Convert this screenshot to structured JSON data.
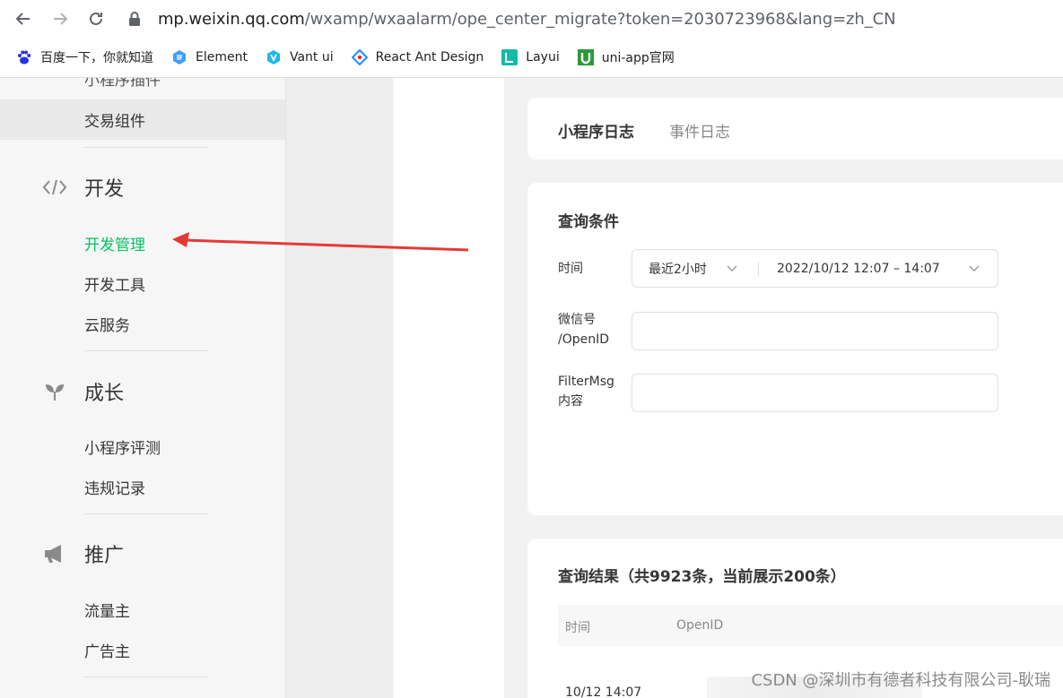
{
  "browser": {
    "url_host": "mp.weixin.qq.com",
    "url_path": "/wxamp/wxaalarm/ope_center_migrate?token=2030723968&lang=zh_CN",
    "bookmarks": [
      {
        "label": "百度一下，你就知道",
        "icon": "baidu-paw-icon",
        "color": "#2932e1"
      },
      {
        "label": "Element",
        "icon": "element-hex-icon",
        "color": "#409eff"
      },
      {
        "label": "Vant ui",
        "icon": "vant-icon",
        "color": "#1989fa"
      },
      {
        "label": "React Ant Design",
        "icon": "ant-design-icon",
        "color": "#1890ff"
      },
      {
        "label": "Layui",
        "icon": "layui-icon",
        "color": "#16baaa"
      },
      {
        "label": "uni-app官网",
        "icon": "uniapp-icon",
        "color": "#2b9939"
      }
    ]
  },
  "sidebar": {
    "clipped_item": "小程序插件",
    "selected_item": "交易组件",
    "groups": [
      {
        "label": "开发",
        "icon": "code-icon",
        "items": [
          "开发管理",
          "开发工具",
          "云服务"
        ]
      },
      {
        "label": "成长",
        "icon": "sprout-icon",
        "items": [
          "小程序评测",
          "违规记录"
        ]
      },
      {
        "label": "推广",
        "icon": "megaphone-icon",
        "items": [
          "流量主",
          "广告主"
        ]
      }
    ],
    "active_color": "#07c160"
  },
  "tabs": {
    "active": "小程序日志",
    "inactive": "事件日志"
  },
  "query": {
    "title": "查询条件",
    "time_label": "时间",
    "time_range_option": "最近2小时",
    "time_range_value": "2022/10/12 12:07 – 14:07",
    "wechat_label_line1": "微信号",
    "wechat_label_line2": "/OpenID",
    "wechat_value": "",
    "filter_label_line1": "FilterMsg",
    "filter_label_line2": "内容",
    "filter_value": ""
  },
  "results": {
    "title": "查询结果（共9923条，当前展示200条）",
    "columns": [
      "时间",
      "OpenID"
    ],
    "first_row_time": "10/12 14:07"
  },
  "annotation": {
    "arrow_color": "#e53935"
  },
  "watermark": "CSDN @深圳市有德者科技有限公司-耿瑞"
}
